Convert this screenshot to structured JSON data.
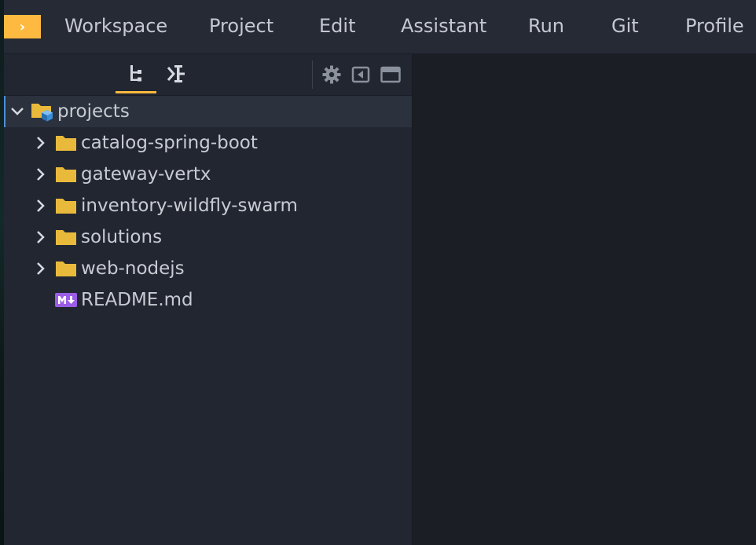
{
  "menubar": {
    "toggle_glyph": "›",
    "items": [
      "Workspace",
      "Project",
      "Edit",
      "Assistant",
      "Run",
      "Git",
      "Profile"
    ]
  },
  "sidebar": {
    "tabs": [
      {
        "name": "project-tree-icon",
        "active": true
      },
      {
        "name": "source-control-icon",
        "active": false
      }
    ],
    "tools": [
      "gear-icon",
      "collapse-panel-icon",
      "maximize-panel-icon"
    ]
  },
  "tree": {
    "root": {
      "label": "projects",
      "icon": "project-folder-icon",
      "expanded": true
    },
    "children": [
      {
        "label": "catalog-spring-boot",
        "type": "folder"
      },
      {
        "label": "gateway-vertx",
        "type": "folder"
      },
      {
        "label": "inventory-wildfly-swarm",
        "type": "folder"
      },
      {
        "label": "solutions",
        "type": "folder"
      },
      {
        "label": "web-nodejs",
        "type": "folder"
      },
      {
        "label": "README.md",
        "type": "markdown"
      }
    ]
  },
  "colors": {
    "accent": "#fdb940",
    "folder": "#e9b93b",
    "markdown": "#9b5de5",
    "selection_border": "#4a90d9"
  }
}
